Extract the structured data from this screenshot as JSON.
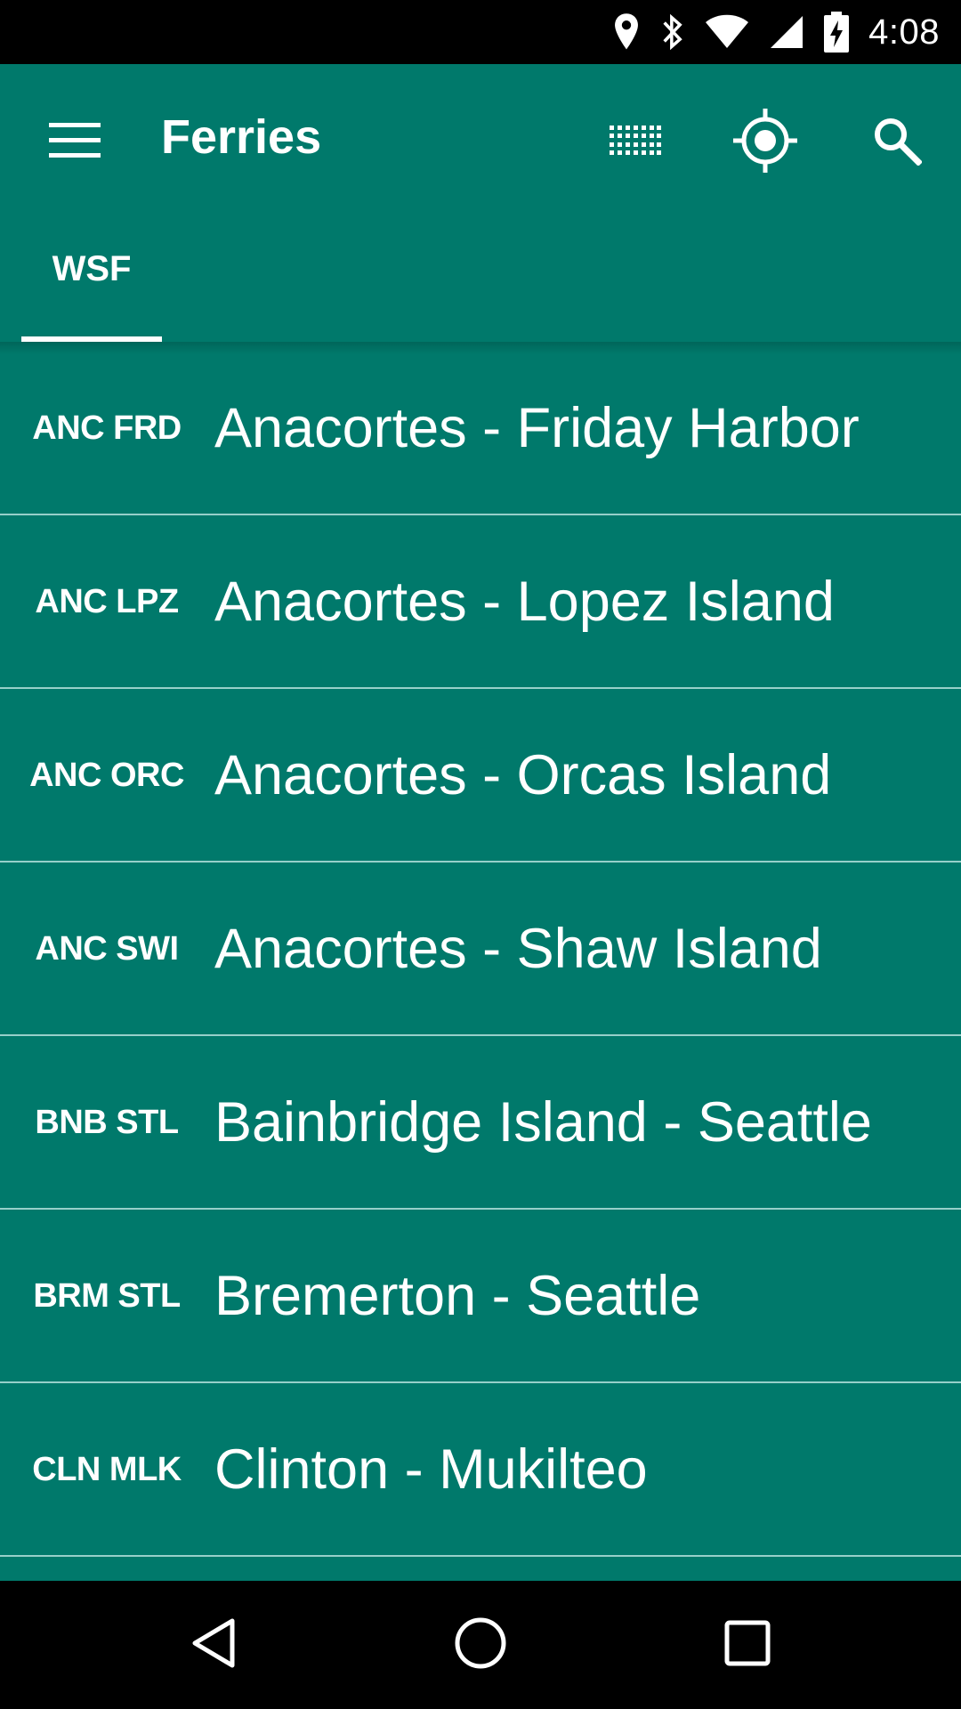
{
  "status_bar": {
    "time": "4:08",
    "icons": [
      "location-icon",
      "bluetooth-icon",
      "wifi-icon",
      "signal-icon",
      "battery-charging-icon"
    ]
  },
  "app_bar": {
    "title": "Ferries",
    "actions": [
      "grid-view-icon",
      "my-location-icon",
      "search-icon"
    ],
    "background_color": "#00796b"
  },
  "tabs": [
    {
      "label": "WSF",
      "selected": true
    }
  ],
  "routes": [
    {
      "code": "ANC FRD",
      "name": "Anacortes - Friday Harbor"
    },
    {
      "code": "ANC LPZ",
      "name": "Anacortes - Lopez Island"
    },
    {
      "code": "ANC ORC",
      "name": "Anacortes - Orcas Island"
    },
    {
      "code": "ANC SWI",
      "name": "Anacortes - Shaw Island"
    },
    {
      "code": "BNB STL",
      "name": "Bainbridge Island - Seattle"
    },
    {
      "code": "BRM STL",
      "name": "Bremerton - Seattle"
    },
    {
      "code": "CLN MLK",
      "name": "Clinton - Mukilteo"
    }
  ],
  "nav_bar": {
    "buttons": [
      "back-icon",
      "home-icon",
      "recents-icon"
    ]
  }
}
